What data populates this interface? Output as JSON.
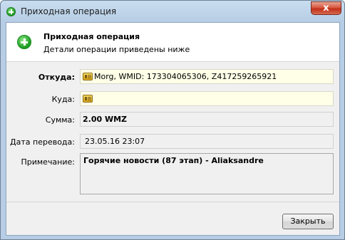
{
  "window": {
    "title": "Приходная операция",
    "close_label": "x"
  },
  "header": {
    "title": "Приходная операция",
    "subtitle": "Детали операции приведены ниже",
    "icon": "plus-circle-icon"
  },
  "form": {
    "from_label": "Откуда:",
    "from_value": "Morg, WMID: 173304065306, Z417259265921",
    "to_label": "Куда:",
    "to_value": "",
    "amount_label": "Сумма:",
    "amount_value": "2.00 WMZ",
    "date_label": "Дата перевода:",
    "date_value": "23.05.16 23:07",
    "note_label": "Примечание:",
    "note_value": "Горячие новости (87 этап) -  Aliaksandre"
  },
  "footer": {
    "close_button": "Закрыть"
  },
  "colors": {
    "titlebar": "#b6cde5",
    "close_red": "#c2301a",
    "field_yellow": "#ffffe8",
    "icon_green": "#1f9d24"
  }
}
